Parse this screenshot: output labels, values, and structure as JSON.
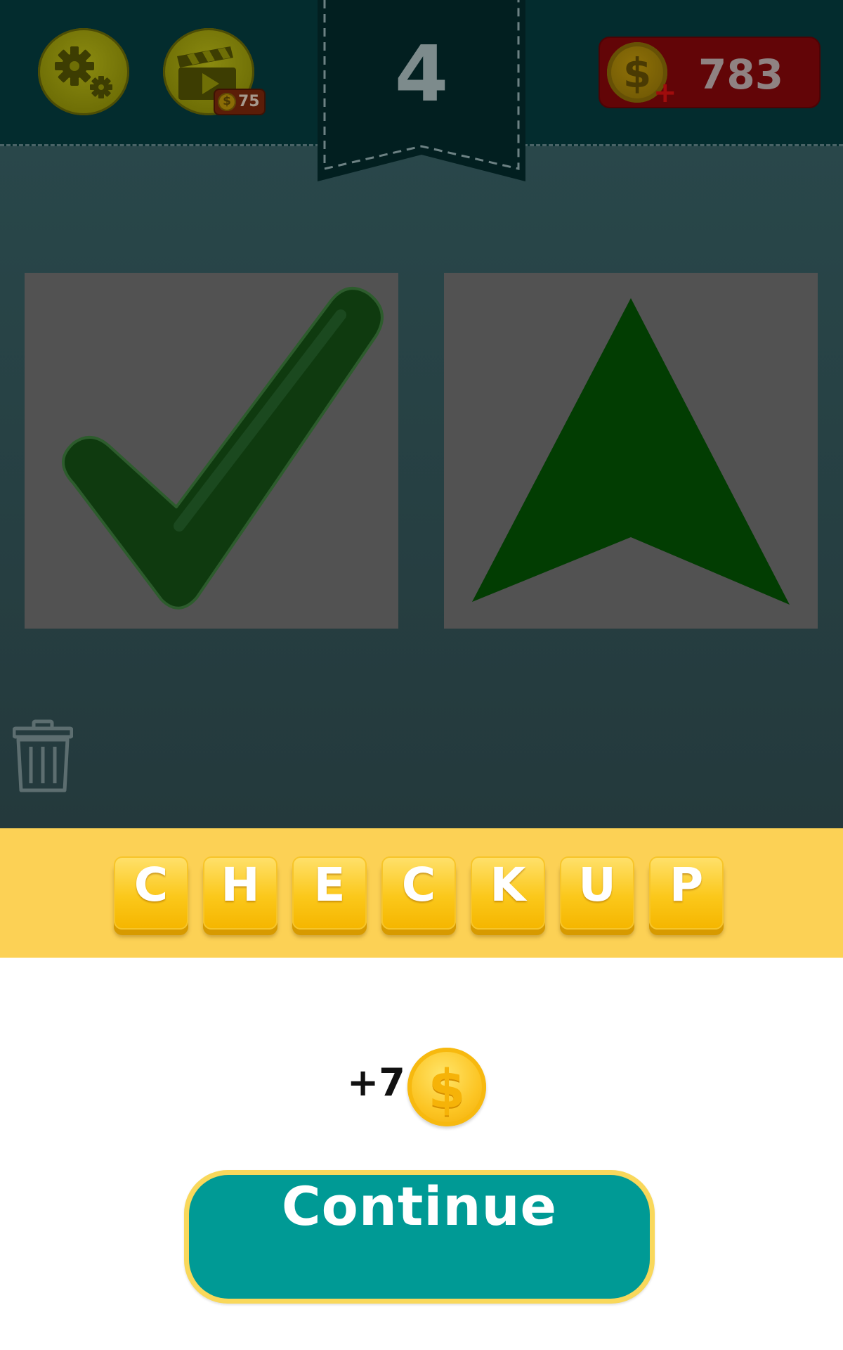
{
  "header": {
    "level": "4",
    "video_reward_cost": "75",
    "coins": "783"
  },
  "icons": {
    "settings": "gear-icon",
    "video": "video-clapper-icon",
    "coin": "dollar-coin-icon",
    "add": "plus-icon",
    "trash": "trash-icon"
  },
  "puzzle": {
    "pictures": [
      "check-mark",
      "up-arrow"
    ]
  },
  "answer": {
    "letters": [
      "C",
      "H",
      "E",
      "C",
      "K",
      "U",
      "P"
    ]
  },
  "reward": {
    "text": "+7"
  },
  "coin_symbol": "$",
  "plus_symbol": "+",
  "continue_label": "Continue",
  "colors": {
    "answer_bar": "#fcd155",
    "tile": "#fbc81b",
    "continue": "#009a95",
    "continue_border": "#f9d85b",
    "picture_green": "#023d02"
  }
}
